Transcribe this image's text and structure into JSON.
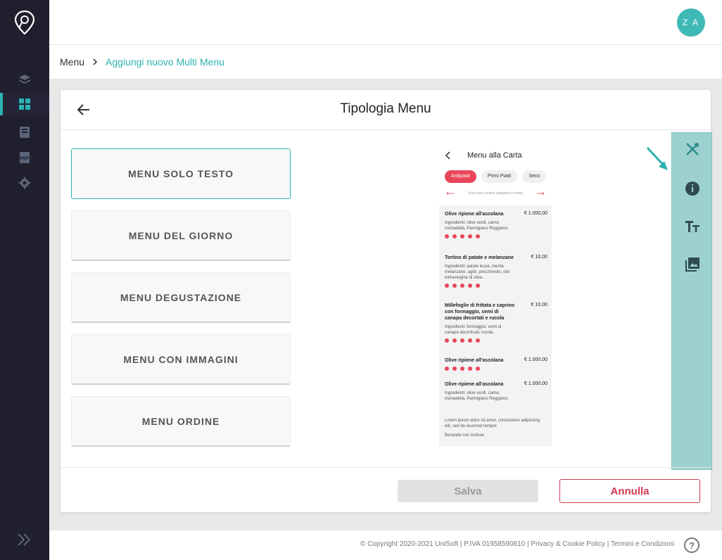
{
  "header": {
    "avatar_initials": "Z A"
  },
  "sidebar": {
    "items": [
      {
        "icon": "layers-icon"
      },
      {
        "icon": "grid-icon",
        "active": true
      },
      {
        "icon": "menu-book-icon"
      },
      {
        "icon": "pdf-icon"
      },
      {
        "icon": "gear-icon"
      }
    ]
  },
  "breadcrumb": {
    "home": "Menu",
    "current": "Aggiungi nuovo Multi Menu"
  },
  "card": {
    "title": "Tipologia Menu",
    "menu_types": [
      {
        "label": "MENU SOLO TESTO",
        "selected": true
      },
      {
        "label": "MENU DEL GIORNO"
      },
      {
        "label": "MENU DEGUSTAZIONE"
      },
      {
        "label": "MENU CON IMMAGINI"
      },
      {
        "label": "MENU ORDINE"
      }
    ],
    "save_label": "Salva",
    "cancel_label": "Annulla"
  },
  "preview": {
    "title": "Menu alla Carta",
    "tabs": [
      "Antipasti",
      "Primi Piatti",
      "Seco"
    ],
    "scroll_hint": "Scorri per vedere categorie e menu",
    "dishes": [
      {
        "name": "Olive ripiene all'ascolana",
        "price": "€ 1.000,00",
        "ingredients": "Ingredienti: olive verdi, carne, mortadella, Parmigiano Reggiano."
      },
      {
        "name": "Tortino di patate e melanzane",
        "price": "€ 10,00",
        "ingredients": "Ingredienti: patate lesse, menta melanzane, aglio, prezzemolo, olio extravergine di oliva."
      },
      {
        "name": "Millefoglie di frittata e caprino con formaggio, semi di canapa decortati e rucola",
        "price": "€ 10,00",
        "ingredients": "Ingredienti: formaggio, semi di canapa decorticati, rucola."
      },
      {
        "name": "Olive ripiene all'ascolana",
        "price": "€ 1.000,00",
        "ingredients": ""
      },
      {
        "name": "Olive ripiene all'ascolana",
        "price": "€ 1.000,00",
        "ingredients": "Ingredienti: olive verdi, carne, mortadella, Parmigiano Reggiano."
      }
    ],
    "footer_note": "Lorem ipsum dolor sit amet, consectetur adipiscing elit, sed do eiusmod tempor.",
    "footer_note2": "Bevande non incluse."
  },
  "toolbar": {
    "items": [
      "cutlery-icon",
      "info-icon",
      "text-size-icon",
      "image-gallery-icon"
    ]
  },
  "footer": {
    "copyright": "© Copyright 2020-2021 UniSoft | P.IVA 01958590810 | Privacy & Cookie Policy | Termini e Condizioni",
    "help": "?"
  },
  "colors": {
    "accent": "#2bb3b1",
    "danger": "#d23a53",
    "sidebar": "#1f1f2e"
  }
}
